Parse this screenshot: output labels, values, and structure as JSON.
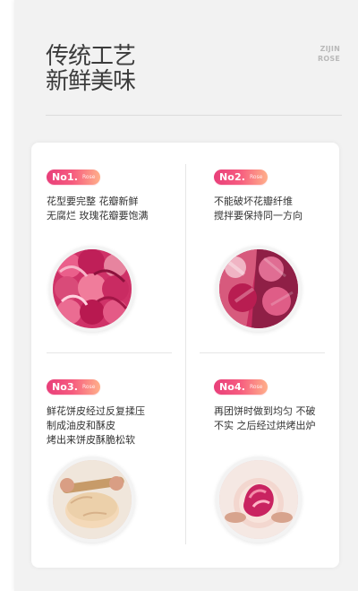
{
  "header": {
    "title_line1": "传统工艺",
    "title_line2": "新鲜美味",
    "brand_line1": "ZIJIN",
    "brand_line2": "ROSE"
  },
  "steps": [
    {
      "badge": "No1.",
      "sub": "Rose",
      "lines": [
        "花型要完整 花瓣新鲜",
        "无腐烂 玫瑰花瓣要饱满"
      ],
      "image": "whole-rose-petals"
    },
    {
      "badge": "No2.",
      "sub": "Rose",
      "lines": [
        "不能破坏花瓣纤维",
        "搅拌要保持同一方向"
      ],
      "image": "rose-mixed-with-sugar"
    },
    {
      "badge": "No3.",
      "sub": "Rose",
      "lines": [
        "鲜花饼皮经过反复揉压",
        "制成油皮和酥皮",
        "烤出来饼皮酥脆松软"
      ],
      "image": "dough-rolling"
    },
    {
      "badge": "No4.",
      "sub": "Rose",
      "lines": [
        "再团饼时做到均匀 不破",
        "不实 之后经过烘烤出炉"
      ],
      "image": "filled-rose-pastry"
    }
  ],
  "colors": {
    "accent_start": "#e83f7a",
    "accent_end": "#ffb08a",
    "text_dark": "#333333",
    "background_panel": "#f2f2f2"
  }
}
